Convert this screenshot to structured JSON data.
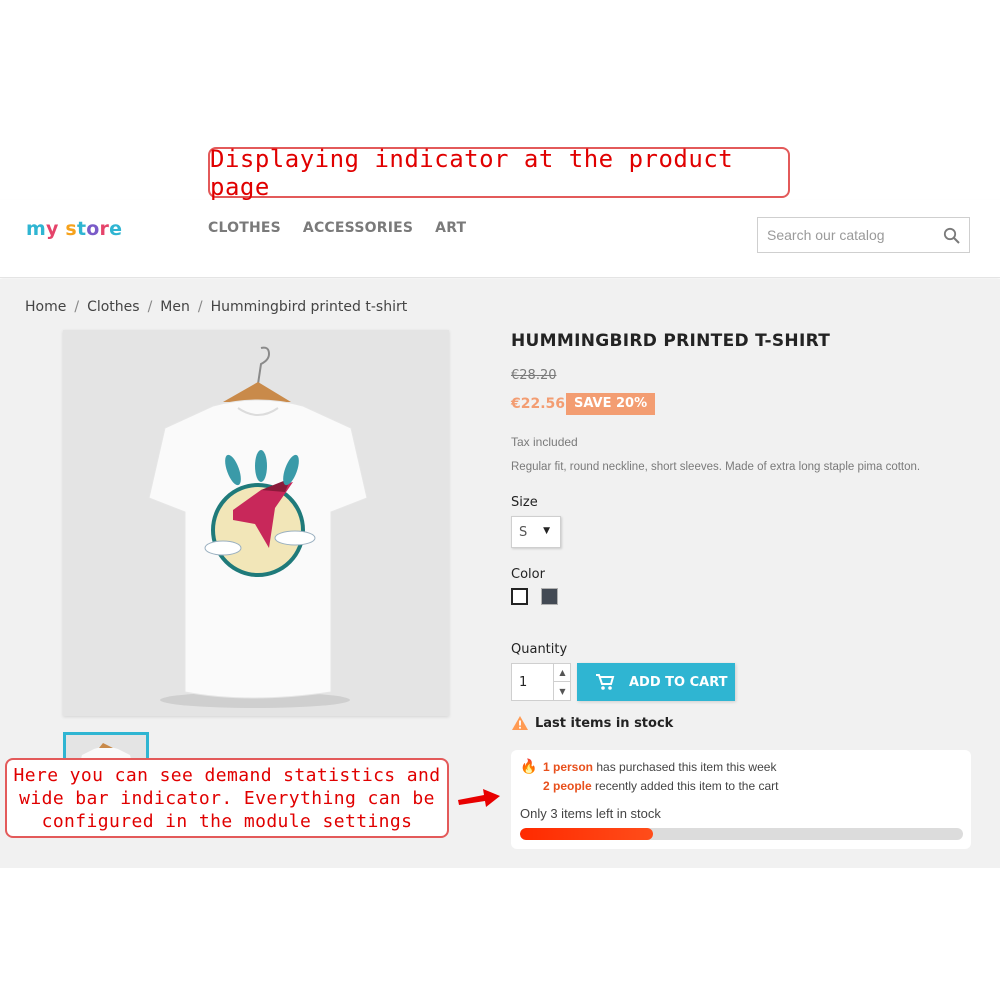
{
  "callouts": {
    "top": "Displaying indicator at the product page",
    "bottom": "Here you can see demand statistics and wide bar indicator. Everything can be configured in the module settings"
  },
  "header": {
    "logo": "my store",
    "nav": [
      "CLOTHES",
      "ACCESSORIES",
      "ART"
    ],
    "search_placeholder": "Search our catalog"
  },
  "breadcrumb": [
    "Home",
    "Clothes",
    "Men",
    "Hummingbird printed t-shirt"
  ],
  "product": {
    "title": "HUMMINGBIRD PRINTED T-SHIRT",
    "old_price": "€28.20",
    "new_price": "€22.56",
    "discount": "SAVE 20%",
    "tax": "Tax included",
    "description": "Regular fit, round neckline, short sleeves. Made of extra long staple pima cotton.",
    "size_label": "Size",
    "size_value": "S",
    "color_label": "Color",
    "colors": [
      "#ffffff",
      "#434a54"
    ],
    "quantity_label": "Quantity",
    "quantity_value": "1",
    "add_to_cart": "ADD TO CART",
    "stock_warning": "Last items in stock"
  },
  "demand": {
    "purchased_count": "1 person",
    "purchased_text": "has purchased this item this week",
    "cart_count": "2 people",
    "cart_text": "recently added this item to the cart",
    "stock_text": "Only 3 items left in stock",
    "bar_fraction": 0.3
  },
  "colors": {
    "accent": "#2fb5d2",
    "price": "#f39d72",
    "highlight": "#e8501c",
    "callout": "#e00000"
  }
}
